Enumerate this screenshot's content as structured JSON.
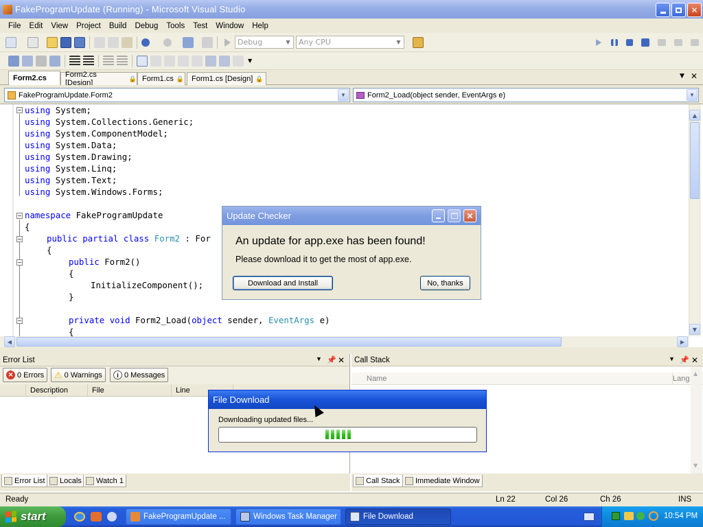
{
  "window": {
    "title": "FakeProgramUpdate (Running) - Microsoft Visual Studio"
  },
  "menu": [
    "File",
    "Edit",
    "View",
    "Project",
    "Build",
    "Debug",
    "Tools",
    "Test",
    "Window",
    "Help"
  ],
  "toolbar": {
    "config": "Debug",
    "platform": "Any CPU"
  },
  "tabs": [
    {
      "label": "Form2.cs",
      "active": true
    },
    {
      "label": "Form2.cs [Design]",
      "active": false
    },
    {
      "label": "Form1.cs",
      "active": false
    },
    {
      "label": "Form1.cs [Design]",
      "active": false
    }
  ],
  "nav": {
    "class_combo": "FakeProgramUpdate.Form2",
    "member_combo": "Form2_Load(object sender, EventArgs e)"
  },
  "code": {
    "l1": "System;",
    "l2": "System.Collections.Generic;",
    "l3": "System.ComponentModel;",
    "l4": "System.Data;",
    "l5": "System.Drawing;",
    "l6": "System.Linq;",
    "l7": "System.Text;",
    "l8": "System.Windows.Forms;",
    "using": "using",
    "namespace_kw": "namespace",
    "namespace_name": " FakeProgramUpdate",
    "brace_open": "{",
    "brace_close": "}",
    "public": "public",
    "partial": "partial",
    "class": "class",
    "class_name": "Form2",
    "colon_base": " : For",
    "ctor": " Form2()",
    "init": "InitializeComponent();",
    "private": "private",
    "void": "void",
    "load_name": " Form2_Load(",
    "object": "object",
    "sender": " sender, ",
    "eventargs": "EventArgs",
    "e": " e)"
  },
  "error_list": {
    "title": "Error List",
    "errors": "0 Errors",
    "warnings": "0 Warnings",
    "messages": "0 Messages",
    "columns": [
      "Description",
      "File",
      "Line"
    ]
  },
  "call_stack": {
    "title": "Call Stack",
    "columns": [
      "Name",
      "Lang"
    ]
  },
  "bottom_tabs_left": [
    "Error List",
    "Locals",
    "Watch 1"
  ],
  "bottom_tabs_right": [
    "Call Stack",
    "Immediate Window"
  ],
  "status": {
    "ready": "Ready",
    "ln": "Ln 22",
    "col": "Col 26",
    "ch": "Ch 26",
    "ins": "INS"
  },
  "update_dialog": {
    "title": "Update Checker",
    "heading": "An update for app.exe has been found!",
    "message": "Please download it to get the most of app.exe.",
    "primary_button": "Download and Install",
    "secondary_button": "No, thanks"
  },
  "download_dialog": {
    "title": "File Download",
    "message": "Downloading updated files...",
    "progress_segments": 5
  },
  "taskbar": {
    "start": "start",
    "items": [
      "FakeProgramUpdate ...",
      "Windows Task Manager",
      "File Download"
    ],
    "clock": "10:54 PM"
  },
  "colors": {
    "keyword": "#0000ff",
    "type": "#2b91af",
    "progress": "#35c21f"
  }
}
